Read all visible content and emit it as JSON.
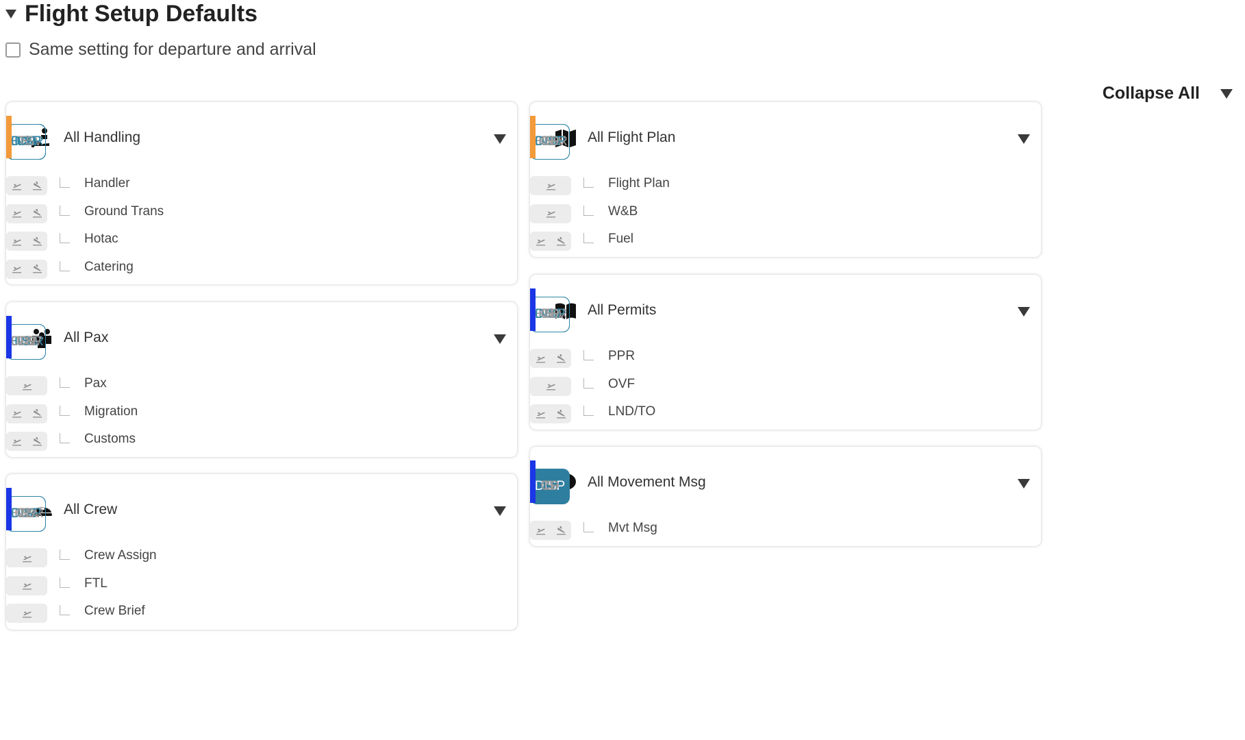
{
  "page": {
    "title": "Flight Setup Defaults",
    "same_setting_label": "Same setting for departure and arrival",
    "collapse_all": "Collapse All"
  },
  "colors": {
    "accent": "#2e7ea0",
    "orange_highlight": "#f39a3a",
    "blue_highlight": "#1b36e6",
    "pill_bg": "#ececec"
  },
  "columns": [
    "N/R",
    "HDLR",
    "CRW",
    "DISP",
    "S",
    "CP",
    "CD",
    "TS"
  ],
  "left_cards": [
    {
      "title": "All Handling",
      "icon": "handling-icon",
      "heads": [
        "outlined",
        "outlined",
        "plain",
        "outlined",
        "plain",
        "outlined",
        "outlined",
        "plain"
      ],
      "rows": [
        {
          "label": "Handler",
          "pills": [
            [
              "off",
              "off"
            ],
            [
              "on",
              "on"
            ],
            [
              "off",
              "off"
            ],
            [
              "off",
              "off"
            ],
            [
              "off",
              "off"
            ],
            [
              "off",
              "off"
            ],
            [
              "off",
              "off"
            ],
            [
              "off",
              "off"
            ]
          ]
        },
        {
          "label": "Ground Trans",
          "pills": [
            [
              "off",
              "off"
            ],
            [
              "off",
              "off"
            ],
            [
              "off",
              "off"
            ],
            [
              "on",
              "on"
            ],
            [
              "off",
              "off"
            ],
            [
              "off",
              "off"
            ],
            [
              "off",
              "off"
            ],
            [
              "off",
              "off"
            ]
          ]
        },
        {
          "label": "Hotac",
          "pills": [
            [
              "on",
              "off"
            ],
            [
              "off",
              "off"
            ],
            [
              "off",
              "off"
            ],
            [
              "off",
              "off"
            ],
            [
              "off",
              "off"
            ],
            [
              "off",
              "on"
            ],
            [
              "off",
              "off"
            ],
            [
              "off",
              "off"
            ]
          ]
        },
        {
          "label": "Catering",
          "pills": [
            [
              "off",
              "on"
            ],
            [
              "off",
              "off"
            ],
            [
              "off",
              "off"
            ],
            [
              "off",
              "off"
            ],
            [
              "off",
              "off"
            ],
            [
              "off",
              "off"
            ],
            [
              "on",
              "off"
            ],
            [
              "off",
              "off"
            ]
          ]
        }
      ]
    },
    {
      "title": "All Pax",
      "icon": "pax-icon",
      "heads": [
        "plain",
        "outlined",
        "plain",
        "plain",
        "outlined",
        "plain",
        "plain",
        "plain"
      ],
      "rows": [
        {
          "label": "Pax",
          "pills": [
            [
              "off"
            ],
            null,
            [
              "off"
            ],
            [
              "off"
            ],
            [
              "on"
            ],
            [
              "off"
            ],
            [
              "off"
            ],
            [
              "off"
            ]
          ]
        },
        {
          "label": "Migration",
          "pills": [
            [
              "off",
              "off"
            ],
            [
              "on",
              "on"
            ],
            [
              "off",
              "off"
            ],
            [
              "off",
              "off"
            ],
            [
              "off",
              "off"
            ],
            [
              "off",
              "off"
            ],
            [
              "off",
              "off"
            ],
            [
              "off",
              "off"
            ]
          ]
        },
        {
          "label": "Customs",
          "pills": [
            [
              "off",
              "off"
            ],
            [
              "on",
              "on"
            ],
            [
              "off",
              "off"
            ],
            [
              "off",
              "off"
            ],
            [
              "off",
              "off"
            ],
            [
              "off",
              "off"
            ],
            [
              "off",
              "off"
            ],
            [
              "off",
              "off"
            ]
          ]
        }
      ]
    },
    {
      "title": "All Crew",
      "icon": "crew-icon",
      "heads": [
        "plain",
        "plain",
        "plain",
        "outlined",
        "plain",
        "outlined",
        "plain",
        "plain"
      ],
      "rows": [
        {
          "label": "Crew Assign",
          "pills": [
            [
              "off"
            ],
            null,
            null,
            [
              "off"
            ],
            [
              "off"
            ],
            [
              "on"
            ],
            [
              "off"
            ],
            [
              "off"
            ]
          ]
        },
        {
          "label": "FTL",
          "pills": [
            [
              "off"
            ],
            null,
            null,
            [
              "off"
            ],
            [
              "off"
            ],
            [
              "on"
            ],
            [
              "off"
            ],
            [
              "off"
            ]
          ]
        },
        {
          "label": "Crew Brief",
          "pills": [
            [
              "off"
            ],
            null,
            null,
            [
              "on"
            ],
            [
              "off"
            ],
            [
              "off"
            ],
            [
              "off"
            ],
            [
              "off"
            ]
          ]
        }
      ]
    }
  ],
  "right_cards": [
    {
      "title": "All Flight Plan",
      "icon": "map-icon",
      "heads": [
        "outlined",
        "plain",
        "plain",
        "outlined",
        "plain",
        "plain",
        "plain",
        "plain"
      ],
      "rows": [
        {
          "label": "Flight Plan",
          "pills": [
            [
              "off"
            ],
            null,
            [
              "off"
            ],
            [
              "on"
            ],
            [
              "off"
            ],
            [
              "off"
            ],
            [
              "off"
            ],
            [
              "off"
            ]
          ]
        },
        {
          "label": "W&B",
          "pills": [
            [
              "off"
            ],
            null,
            [
              "off"
            ],
            [
              "on"
            ],
            [
              "off"
            ],
            [
              "off"
            ],
            [
              "off"
            ],
            [
              "off"
            ]
          ]
        },
        {
          "label": "Fuel",
          "pills": [
            [
              "off",
              "on"
            ],
            [
              "off",
              "off"
            ],
            [
              "off",
              "off"
            ],
            [
              "on",
              "off"
            ],
            [
              "off",
              "off"
            ],
            [
              "off",
              "off"
            ],
            [
              "off",
              "off"
            ],
            [
              "off",
              "off"
            ]
          ]
        }
      ]
    },
    {
      "title": "All Permits",
      "icon": "book-icon",
      "heads": [
        "outlined",
        "plain",
        "plain",
        "outlined",
        "plain",
        "plain",
        "plain",
        "plain"
      ],
      "rows": [
        {
          "label": "PPR",
          "pills": [
            [
              "off",
              "off"
            ],
            [
              "off",
              "off"
            ],
            [
              "off",
              "off"
            ],
            [
              "on",
              "on"
            ],
            [
              "off",
              "off"
            ],
            [
              "off",
              "off"
            ],
            [
              "off",
              "off"
            ],
            [
              "off",
              "off"
            ]
          ]
        },
        {
          "label": "OVF",
          "pills": [
            [
              "on"
            ],
            [
              "off"
            ],
            [
              "off"
            ],
            [
              "off"
            ],
            [
              "off"
            ],
            [
              "off"
            ],
            [
              "off"
            ],
            [
              "off"
            ]
          ]
        },
        {
          "label": "LND/TO",
          "pills": [
            [
              "on",
              "on"
            ],
            [
              "off",
              "off"
            ],
            [
              "off",
              "off"
            ],
            [
              "off",
              "off"
            ],
            [
              "off",
              "off"
            ],
            [
              "off",
              "off"
            ],
            [
              "off",
              "off"
            ],
            [
              "off",
              "off"
            ]
          ]
        }
      ]
    },
    {
      "title": "All Movement Msg",
      "icon": "speech-bubble-icon",
      "heads": [
        "plain",
        "plain",
        "plain",
        "filled",
        "plain",
        "plain",
        "plain",
        "plain"
      ],
      "rows": [
        {
          "label": "Mvt Msg",
          "pills": [
            [
              "off",
              "off"
            ],
            null,
            [
              "off",
              "off"
            ],
            [
              "on",
              "on"
            ],
            [
              "off",
              "off"
            ],
            [
              "off",
              "off"
            ],
            [
              "off",
              "off"
            ],
            null
          ]
        }
      ]
    }
  ]
}
